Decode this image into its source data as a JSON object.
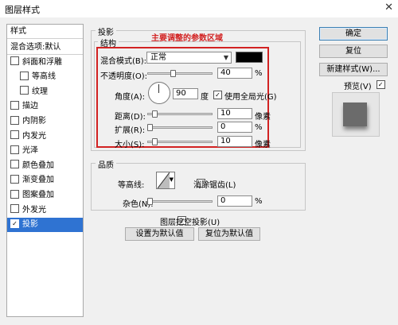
{
  "window": {
    "title": "图层样式",
    "close_glyph": "✕"
  },
  "style_list": {
    "header": "样式",
    "items": [
      {
        "label": "混合选项:默认",
        "checkbox": false,
        "indent": false,
        "checked": false,
        "selected": false
      },
      {
        "label": "斜面和浮雕",
        "checkbox": true,
        "indent": false,
        "checked": false,
        "selected": false
      },
      {
        "label": "等高线",
        "checkbox": true,
        "indent": true,
        "checked": false,
        "selected": false
      },
      {
        "label": "纹理",
        "checkbox": true,
        "indent": true,
        "checked": false,
        "selected": false
      },
      {
        "label": "描边",
        "checkbox": true,
        "indent": false,
        "checked": false,
        "selected": false
      },
      {
        "label": "内阴影",
        "checkbox": true,
        "indent": false,
        "checked": false,
        "selected": false
      },
      {
        "label": "内发光",
        "checkbox": true,
        "indent": false,
        "checked": false,
        "selected": false
      },
      {
        "label": "光泽",
        "checkbox": true,
        "indent": false,
        "checked": false,
        "selected": false
      },
      {
        "label": "颜色叠加",
        "checkbox": true,
        "indent": false,
        "checked": false,
        "selected": false
      },
      {
        "label": "渐变叠加",
        "checkbox": true,
        "indent": false,
        "checked": false,
        "selected": false
      },
      {
        "label": "图案叠加",
        "checkbox": true,
        "indent": false,
        "checked": false,
        "selected": false
      },
      {
        "label": "外发光",
        "checkbox": true,
        "indent": false,
        "checked": false,
        "selected": false
      },
      {
        "label": "投影",
        "checkbox": true,
        "indent": false,
        "checked": true,
        "selected": true
      }
    ]
  },
  "shadow": {
    "section_title": "投影",
    "structure_title": "结构",
    "annotation": "主要调整的参数区域",
    "blend_mode": {
      "label": "混合模式(B):",
      "value": "正常",
      "color": "#000000"
    },
    "opacity": {
      "label": "不透明度(O):",
      "value": "40",
      "unit": "%"
    },
    "angle": {
      "label": "角度(A):",
      "value": "90",
      "unit": "度",
      "global_light_label": "使用全局光(G)",
      "global_light_checked": true
    },
    "distance": {
      "label": "距离(D):",
      "value": "10",
      "unit": "像素"
    },
    "spread": {
      "label": "扩展(R):",
      "value": "0",
      "unit": "%"
    },
    "size": {
      "label": "大小(S):",
      "value": "10",
      "unit": "像素"
    }
  },
  "quality": {
    "title": "品质",
    "contour_label": "等高线:",
    "antialias_label": "消除锯齿(L)",
    "antialias_checked": false,
    "noise": {
      "label": "杂色(N):",
      "value": "0",
      "unit": "%"
    }
  },
  "knockout": {
    "label": "图层挖空投影(U)",
    "checked": true
  },
  "buttons": {
    "make_default": "设置为默认值",
    "reset_default": "复位为默认值",
    "ok": "确定",
    "reset": "复位",
    "new_style": "新建样式(W)...",
    "preview_label": "预览(V)",
    "preview_checked": true
  },
  "colors": {
    "accent": "#2f73d2",
    "annotation": "#d22222"
  },
  "check_glyph": "✓",
  "arrow_glyph": "▼"
}
